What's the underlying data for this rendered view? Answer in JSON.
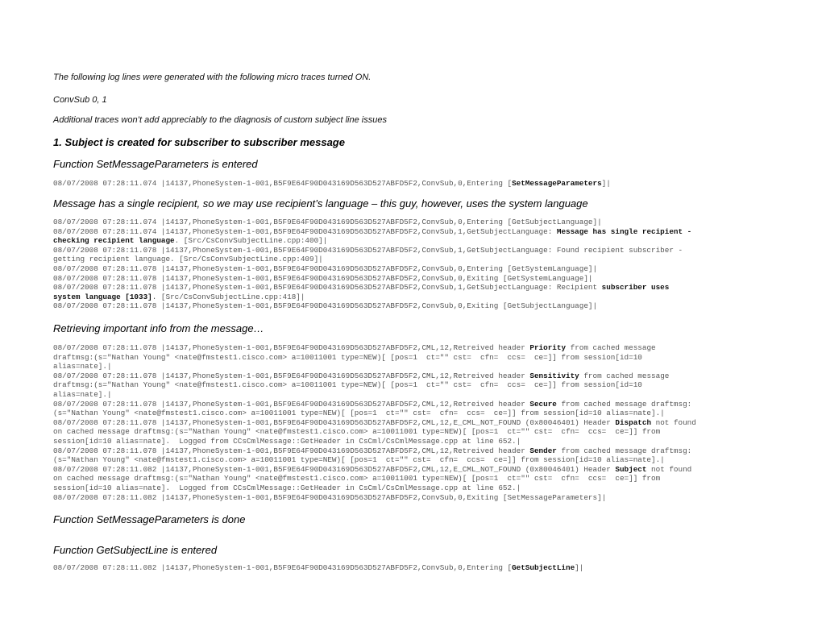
{
  "intro": {
    "line1": "The following log lines were generated with the following micro traces turned ON.",
    "line2": "ConvSub 0, 1",
    "line3": "Additional traces won’t add appreciably to the diagnosis of custom subject line issues"
  },
  "section1": {
    "title": "1. Subject is created for subscriber to subscriber message",
    "func_entered": "Function SetMessageParameters is entered",
    "log1": [
      {
        "pre": "08/07/2008 07:28:11.074 |14137,PhoneSystem-1-001,B5F9E64F90D043169D563D527ABFD5F2,ConvSub,0,Entering [",
        "bold": "SetMessageParameters",
        "post": "]|"
      }
    ],
    "note_language": "Message has a single recipient, so we may use recipient’s language – this guy, however, uses the system language",
    "log2": [
      {
        "pre": "08/07/2008 07:28:11.074 |14137,PhoneSystem-1-001,B5F9E64F90D043169D563D527ABFD5F2,ConvSub,0,Entering [GetSubjectLanguage]|",
        "bold": "",
        "post": ""
      },
      {
        "pre": "08/07/2008 07:28:11.074 |14137,PhoneSystem-1-001,B5F9E64F90D043169D563D527ABFD5F2,ConvSub,1,GetSubjectLanguage: ",
        "bold": "Message has single recipient -",
        "post": ""
      },
      {
        "pre": "",
        "bold": "checking recipient language",
        "post": ". [Src/CsConvSubjectLine.cpp:400]|"
      },
      {
        "pre": "08/07/2008 07:28:11.078 |14137,PhoneSystem-1-001,B5F9E64F90D043169D563D527ABFD5F2,ConvSub,1,GetSubjectLanguage: Found recipient subscriber -",
        "bold": "",
        "post": ""
      },
      {
        "pre": "getting recipient language. [Src/CsConvSubjectLine.cpp:409]|",
        "bold": "",
        "post": ""
      },
      {
        "pre": "08/07/2008 07:28:11.078 |14137,PhoneSystem-1-001,B5F9E64F90D043169D563D527ABFD5F2,ConvSub,0,Entering [GetSystemLanguage]|",
        "bold": "",
        "post": ""
      },
      {
        "pre": "08/07/2008 07:28:11.078 |14137,PhoneSystem-1-001,B5F9E64F90D043169D563D527ABFD5F2,ConvSub,0,Exiting [GetSystemLanguage]|",
        "bold": "",
        "post": ""
      },
      {
        "pre": "08/07/2008 07:28:11.078 |14137,PhoneSystem-1-001,B5F9E64F90D043169D563D527ABFD5F2,ConvSub,1,GetSubjectLanguage: Recipient ",
        "bold": "subscriber uses",
        "post": ""
      },
      {
        "pre": "",
        "bold": "system language [1033]",
        "post": ". [Src/CsConvSubjectLine.cpp:418]|"
      },
      {
        "pre": "08/07/2008 07:28:11.078 |14137,PhoneSystem-1-001,B5F9E64F90D043169D563D527ABFD5F2,ConvSub,0,Exiting [GetSubjectLanguage]|",
        "bold": "",
        "post": ""
      }
    ],
    "note_retrieving": "Retrieving important info from the message…",
    "log3": [
      {
        "pre": "08/07/2008 07:28:11.078 |14137,PhoneSystem-1-001,B5F9E64F90D043169D563D527ABFD5F2,CML,12,Retreived header ",
        "bold": "Priority",
        "post": " from cached message"
      },
      {
        "pre": "draftmsg:(s=\"Nathan Young\" <nate@fmstest1.cisco.com> a=10011001 type=NEW)[ [pos=1  ct=\"\" cst=  cfn=  ccs=  ce=]] from session[id=10",
        "bold": "",
        "post": ""
      },
      {
        "pre": "alias=nate].|",
        "bold": "",
        "post": ""
      },
      {
        "pre": "08/07/2008 07:28:11.078 |14137,PhoneSystem-1-001,B5F9E64F90D043169D563D527ABFD5F2,CML,12,Retreived header ",
        "bold": "Sensitivity",
        "post": " from cached message"
      },
      {
        "pre": "draftmsg:(s=\"Nathan Young\" <nate@fmstest1.cisco.com> a=10011001 type=NEW)[ [pos=1  ct=\"\" cst=  cfn=  ccs=  ce=]] from session[id=10",
        "bold": "",
        "post": ""
      },
      {
        "pre": "alias=nate].|",
        "bold": "",
        "post": ""
      },
      {
        "pre": "08/07/2008 07:28:11.078 |14137,PhoneSystem-1-001,B5F9E64F90D043169D563D527ABFD5F2,CML,12,Retreived header ",
        "bold": "Secure",
        "post": " from cached message draftmsg:"
      },
      {
        "pre": "(s=\"Nathan Young\" <nate@fmstest1.cisco.com> a=10011001 type=NEW)[ [pos=1  ct=\"\" cst=  cfn=  ccs=  ce=]] from session[id=10 alias=nate].|",
        "bold": "",
        "post": ""
      },
      {
        "pre": "08/07/2008 07:28:11.078 |14137,PhoneSystem-1-001,B5F9E64F90D043169D563D527ABFD5F2,CML,12,E_CML_NOT_FOUND (0x80046401) Header ",
        "bold": "Dispatch",
        "post": " not found"
      },
      {
        "pre": "on cached message draftmsg:(s=\"Nathan Young\" <nate@fmstest1.cisco.com> a=10011001 type=NEW)[ [pos=1  ct=\"\" cst=  cfn=  ccs=  ce=]] from",
        "bold": "",
        "post": ""
      },
      {
        "pre": "session[id=10 alias=nate].  Logged from CCsCmlMessage::GetHeader in CsCml/CsCmlMessage.cpp at line 652.|",
        "bold": "",
        "post": ""
      },
      {
        "pre": "08/07/2008 07:28:11.078 |14137,PhoneSystem-1-001,B5F9E64F90D043169D563D527ABFD5F2,CML,12,Retreived header ",
        "bold": "Sender",
        "post": " from cached message draftmsg:"
      },
      {
        "pre": "(s=\"Nathan Young\" <nate@fmstest1.cisco.com> a=10011001 type=NEW)[ [pos=1  ct=\"\" cst=  cfn=  ccs=  ce=]] from session[id=10 alias=nate].|",
        "bold": "",
        "post": ""
      },
      {
        "pre": "08/07/2008 07:28:11.082 |14137,PhoneSystem-1-001,B5F9E64F90D043169D563D527ABFD5F2,CML,12,E_CML_NOT_FOUND (0x80046401) Header ",
        "bold": "Subject",
        "post": " not found"
      },
      {
        "pre": "on cached message draftmsg:(s=\"Nathan Young\" <nate@fmstest1.cisco.com> a=10011001 type=NEW)[ [pos=1  ct=\"\" cst=  cfn=  ccs=  ce=]] from",
        "bold": "",
        "post": ""
      },
      {
        "pre": "session[id=10 alias=nate].  Logged from CCsCmlMessage::GetHeader in CsCml/CsCmlMessage.cpp at line 652.|",
        "bold": "",
        "post": ""
      },
      {
        "pre": "08/07/2008 07:28:11.082 |14137,PhoneSystem-1-001,B5F9E64F90D043169D563D527ABFD5F2,ConvSub,0,Exiting [SetMessageParameters]|",
        "bold": "",
        "post": ""
      }
    ],
    "func_done": "Function SetMessageParameters is done",
    "func_getsubject": "Function GetSubjectLine is entered",
    "log4": [
      {
        "pre": "08/07/2008 07:28:11.082 |14137,PhoneSystem-1-001,B5F9E64F90D043169D563D527ABFD5F2,ConvSub,0,Entering [",
        "bold": "GetSubjectLine",
        "post": "]|"
      }
    ]
  }
}
